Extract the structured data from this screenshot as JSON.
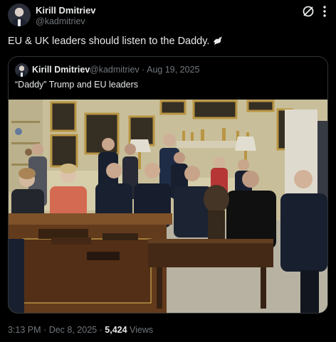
{
  "post": {
    "author_name": "Kirill Dmitriev",
    "author_handle": "@kadmitriev",
    "text": "EU & UK leaders should listen to the Daddy.",
    "emoji_icon": "dove-icon",
    "header_icons": [
      "grok-icon",
      "more-icon"
    ]
  },
  "quote": {
    "author_name": "Kirill Dmitriev",
    "author_handle": "@kadmitriev",
    "date": "Aug 19, 2025",
    "meta_separator": "·",
    "text": "“Daddy” Trump and EU leaders",
    "image": {
      "subject": "photo-oval-office-meeting",
      "colors": {
        "wall": "#d9cfa6",
        "gold": "#c9a24a",
        "desk": "#6b3f1f",
        "suit": "#1b2233",
        "floor": "#c8c2b0"
      }
    }
  },
  "footer": {
    "time": "3:13 PM",
    "separator": "·",
    "date": "Dec 8, 2025",
    "views_count": "5,424",
    "views_label": "Views"
  },
  "theme": {
    "background": "#000000",
    "text": "#e7e9ea",
    "muted": "#71767b",
    "border": "#2f3336"
  }
}
